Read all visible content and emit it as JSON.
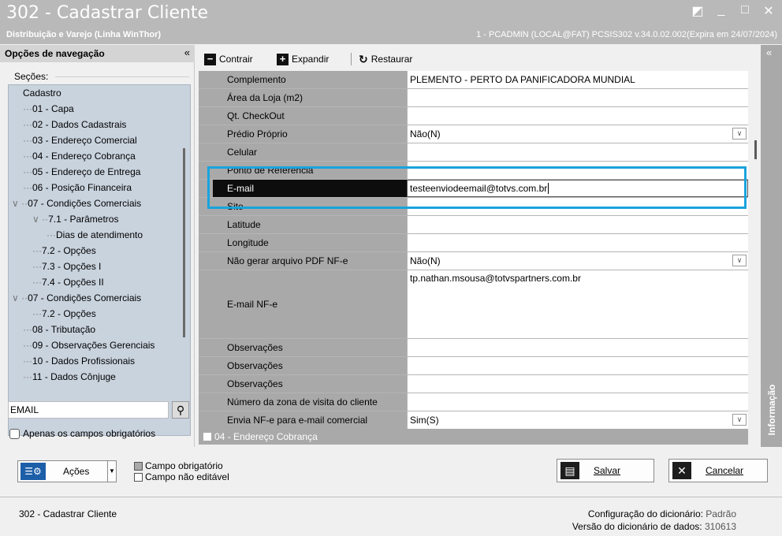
{
  "window": {
    "title": "302 - Cadastrar Cliente",
    "subtitle": "Distribuição e Varejo (Linha WinThor)",
    "info": "1 - PCADMIN (LOCAL@FAT)   PCSIS302  v.34.0.02.002(Expira em 24/07/2024)"
  },
  "nav": {
    "header": "Opções de navegação",
    "sections_label": "Seções:",
    "items": [
      {
        "text": "Cadastro",
        "prefix": ""
      },
      {
        "text": "01 - Capa",
        "prefix": "···"
      },
      {
        "text": "02 - Dados Cadastrais",
        "prefix": "···"
      },
      {
        "text": "03 - Endereço Comercial",
        "prefix": "···"
      },
      {
        "text": "04 - Endereço Cobrança",
        "prefix": "···"
      },
      {
        "text": "05 - Endereço de Entrega",
        "prefix": "···"
      },
      {
        "text": "06 - Posição Financeira",
        "prefix": "···"
      },
      {
        "text": "07 - Condições Comerciais",
        "prefix": "∨ ··"
      },
      {
        "text": "7.1 - Parâmetros",
        "prefix": "∨ ··"
      },
      {
        "text": "Dias de atendimento",
        "prefix": "···"
      },
      {
        "text": "7.2 - Opções",
        "prefix": "···"
      },
      {
        "text": "7.3 - Opções I",
        "prefix": "···"
      },
      {
        "text": "7.4 - Opções II",
        "prefix": "···"
      },
      {
        "text": "07 - Condições Comerciais",
        "prefix": "∨ ··"
      },
      {
        "text": "7.2 - Opções",
        "prefix": "···"
      },
      {
        "text": "08 - Tributação",
        "prefix": "···"
      },
      {
        "text": "09 - Observações Gerenciais",
        "prefix": "···"
      },
      {
        "text": "10 - Dados Profissionais",
        "prefix": "···"
      },
      {
        "text": "11 - Dados Cônjuge",
        "prefix": "···"
      }
    ],
    "search_value": "EMAIL",
    "only_required_label": "Apenas os campos obrigatórios"
  },
  "toolbar": {
    "collapse": "Contrair",
    "expand": "Expandir",
    "restore": "Restaurar"
  },
  "grid": {
    "rows": [
      {
        "label": "Complemento",
        "value": "PLEMENTO - PERTO DA PANIFICADORA MUNDIAL",
        "dropdown": false
      },
      {
        "label": "Área da Loja (m2)",
        "value": "",
        "dropdown": false
      },
      {
        "label": "Qt. CheckOut",
        "value": "",
        "dropdown": false
      },
      {
        "label": "Prédio Próprio",
        "value": "Não(N)",
        "dropdown": true
      },
      {
        "label": "Celular",
        "value": "",
        "dropdown": false
      },
      {
        "label": "Ponto de Referência",
        "value": "",
        "dropdown": false
      },
      {
        "label": "E-mail",
        "value": "testeenviodeemail@totvs.com.br",
        "dropdown": false,
        "selected": true
      },
      {
        "label": "Site",
        "value": "",
        "dropdown": false
      },
      {
        "label": "Latitude",
        "value": "",
        "dropdown": false
      },
      {
        "label": "Longitude",
        "value": "",
        "dropdown": false
      },
      {
        "label": "Não gerar arquivo PDF NF-e",
        "value": "Não(N)",
        "dropdown": true
      },
      {
        "label": "E-mail NF-e",
        "value": "tp.nathan.msousa@totvspartners.com.br",
        "dropdown": false,
        "tall": true
      },
      {
        "label": "Observações",
        "value": "",
        "dropdown": false
      },
      {
        "label": "Observações",
        "value": "",
        "dropdown": false
      },
      {
        "label": "Observações",
        "value": "",
        "dropdown": false
      },
      {
        "label": "Número da zona de visita do cliente",
        "value": "",
        "dropdown": false
      },
      {
        "label": "Envia NF-e para e-mail comercial",
        "value": "Sim(S)",
        "dropdown": true
      }
    ],
    "next_section": "04 - Endereço Cobrança"
  },
  "right_panel": {
    "label": "Informação"
  },
  "actions": {
    "acoes": "Ações",
    "legend_required": "Campo obrigatório",
    "legend_readonly": "Campo não editável",
    "save": "Salvar",
    "cancel": "Cancelar"
  },
  "status": {
    "screen": "302 - Cadastrar Cliente",
    "dict_config_label": "Configuração do dicionário:",
    "dict_config_value": "Padrão",
    "dict_version_label": "Versão do dicionário de dados:",
    "dict_version_value": "310613"
  },
  "colors": {
    "highlight": "#1aa3dd",
    "title_bar": "#b9b9b9",
    "tree_bg": "#c9d3de"
  }
}
